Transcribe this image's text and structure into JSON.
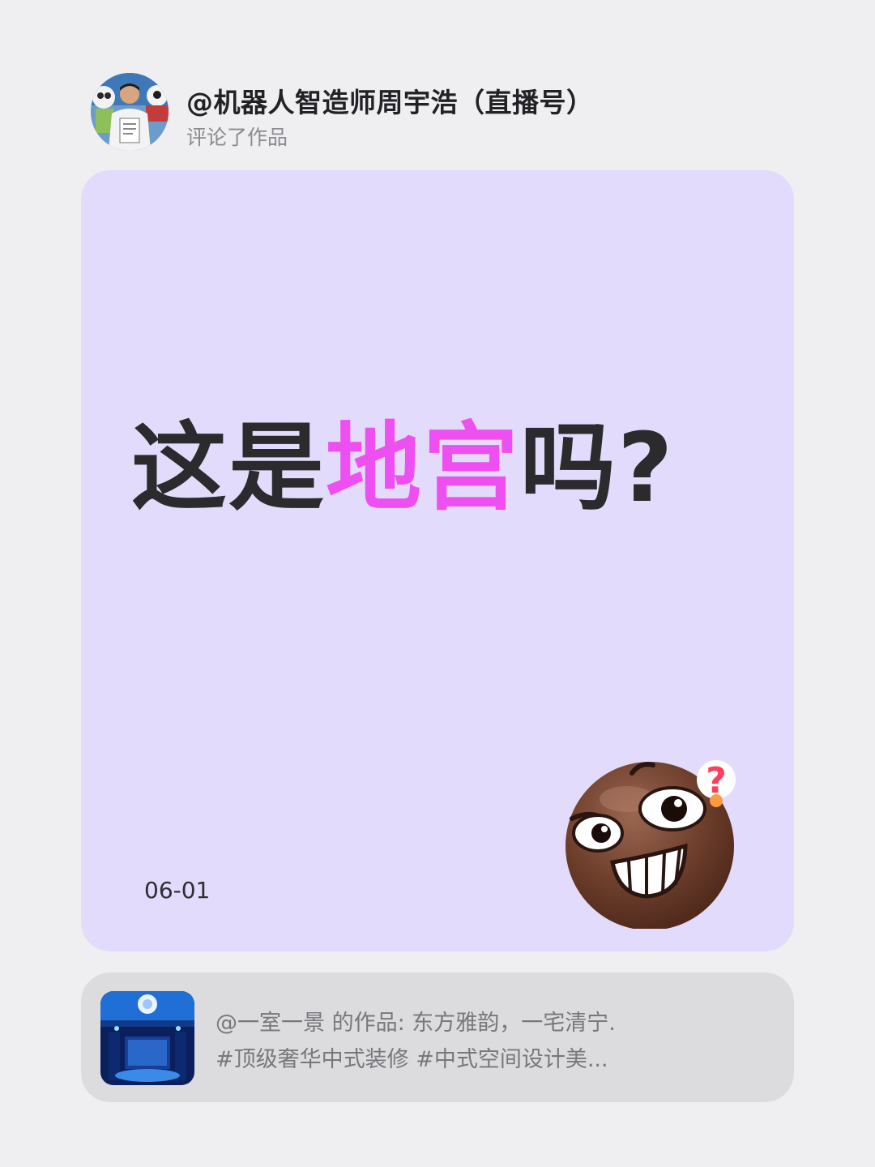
{
  "header": {
    "username": "@机器人智造师周宇浩（直播号）",
    "action": "评论了作品"
  },
  "card": {
    "headline_part1": "这是",
    "headline_highlight": "地宫",
    "headline_part2": "吗?",
    "date": "06-01",
    "background": "#e3dbfb",
    "highlight_color": "#ee4ff0"
  },
  "reference": {
    "line1": "@一室一景 的作品: 东方雅韵，一宅清宁.",
    "line2": "#顶级奢华中式装修 #中式空间设计美..."
  }
}
